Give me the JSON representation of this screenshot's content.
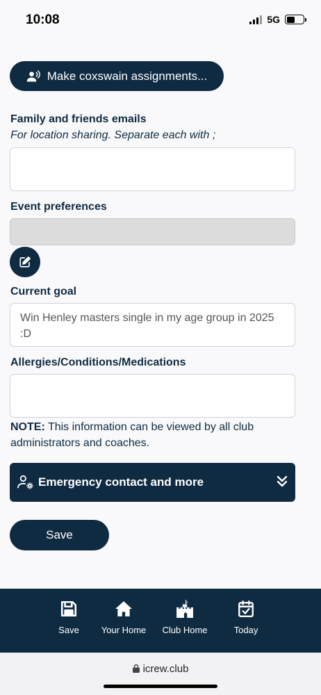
{
  "status_bar": {
    "time": "10:08",
    "network": "5G"
  },
  "coxswain_button": {
    "label": "Make coxswain assignments...",
    "icon": "person-speaking-icon"
  },
  "family_emails": {
    "label": "Family and friends emails",
    "hint": "For location sharing. Separate each with ;",
    "value": ""
  },
  "event_preferences": {
    "label": "Event preferences",
    "value": "",
    "edit_icon": "edit-icon"
  },
  "current_goal": {
    "label": "Current goal",
    "value": "Win Henley masters single in my age group in 2025 :D"
  },
  "allergies": {
    "label": "Allergies/Conditions/Medications",
    "value": ""
  },
  "note": {
    "prefix": "NOTE:",
    "text": " This information can be viewed by all club administrators and coaches."
  },
  "emergency_section": {
    "label": "Emergency contact and more",
    "icon": "user-gear-icon",
    "expand_icon": "double-chevron-down-icon"
  },
  "save_button": {
    "label": "Save"
  },
  "bottom_nav": {
    "items": [
      {
        "label": "Save",
        "icon": "floppy-disk-icon"
      },
      {
        "label": "Your Home",
        "icon": "home-icon"
      },
      {
        "label": "Club Home",
        "icon": "castle-icon"
      },
      {
        "label": "Today",
        "icon": "calendar-check-icon"
      }
    ]
  },
  "browser": {
    "url": "icrew.club"
  },
  "colors": {
    "primary": "#0f2b42",
    "background": "#f9f9fb"
  }
}
